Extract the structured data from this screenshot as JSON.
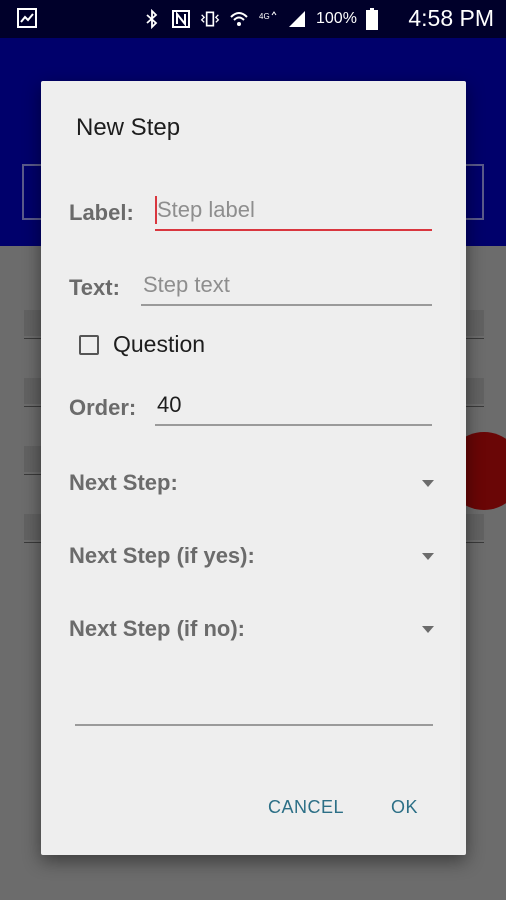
{
  "status_bar": {
    "battery_percent": "100%",
    "time": "4:58 PM",
    "icons": [
      "gallery-icon",
      "bluetooth-icon",
      "nfc-icon",
      "vibrate-icon",
      "wifi-icon",
      "lte-icon",
      "signal-icon",
      "battery-icon"
    ]
  },
  "dialog": {
    "title": "New Step",
    "label_field": {
      "label": "Label:",
      "value": "",
      "placeholder": "Step label"
    },
    "text_field": {
      "label": "Text:",
      "value": "",
      "placeholder": "Step text"
    },
    "question_checkbox": {
      "label": "Question",
      "checked": false
    },
    "order_field": {
      "label": "Order:",
      "value": "40"
    },
    "next_step": {
      "label": "Next Step:",
      "selected": ""
    },
    "next_step_yes": {
      "label": "Next Step (if yes):",
      "selected": ""
    },
    "next_step_no": {
      "label": "Next Step (if no):",
      "selected": ""
    },
    "buttons": {
      "cancel": "CANCEL",
      "ok": "OK"
    }
  },
  "colors": {
    "accent": "#d9363e",
    "button_text": "#2c6f86",
    "app_bar": "#00006b",
    "status_bar": "#00002a"
  }
}
